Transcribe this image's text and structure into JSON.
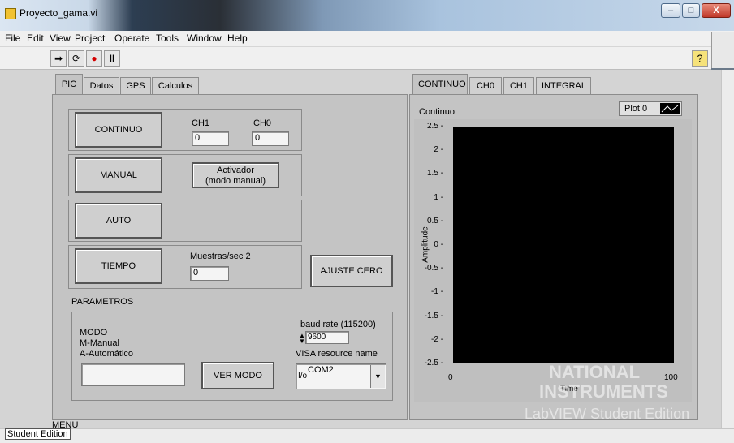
{
  "window": {
    "title": "Proyecto_gama.vi",
    "buttons": {
      "minimize": "–",
      "maximize": "□",
      "close": "X"
    }
  },
  "menu": [
    "File",
    "Edit",
    "View",
    "Project",
    "Operate",
    "Tools",
    "Window",
    "Help"
  ],
  "toolbar": {
    "run": "➡",
    "run_continuous": "⟳",
    "abort": "●",
    "pause": "II",
    "help": "?"
  },
  "left_tabs": {
    "tabs": [
      "PIC",
      "Datos",
      "GPS",
      "Calculos"
    ],
    "active": "PIC"
  },
  "pic": {
    "continuo_btn": "CONTINUO",
    "ch1_label": "CH1",
    "ch0_label": "CH0",
    "ch1_value": "0",
    "ch0_value": "0",
    "manual_btn": "MANUAL",
    "activador_line1": "Activador",
    "activador_line2": "(modo manual)",
    "auto_btn": "AUTO",
    "tiempo_btn": "TIEMPO",
    "muestras_label": "Muestras/sec 2",
    "muestras_value": "0",
    "ajuste_btn": "AJUSTE CERO",
    "parametros_label": "PARAMETROS",
    "modo_line1": "MODO",
    "modo_line2": "M-Manual",
    "modo_line3": "A-Automático",
    "modo_value": "",
    "ver_modo_btn": "VER MODO",
    "baud_label": "baud rate (115200)",
    "baud_value": "9600",
    "visa_label": "VISA resource name",
    "visa_value": "COM2",
    "menu_label": "MENU"
  },
  "right_tabs": {
    "tabs": [
      "CONTINUO",
      "CH0",
      "CH1",
      "INTEGRAL"
    ],
    "active": "CONTINUO"
  },
  "graph": {
    "title": "Continuo",
    "legend": "Plot 0",
    "ylabel": "Amplitude",
    "xlabel": "Time",
    "yticks": [
      "2.5",
      "2",
      "1.5",
      "1",
      "0.5",
      "0",
      "-0.5",
      "-1",
      "-1.5",
      "-2",
      "-2.5"
    ],
    "xticks": [
      "0",
      "100"
    ]
  },
  "watermark": {
    "line1": "NATIONAL",
    "line2": "INSTRUMENTS",
    "line3": "LabVIEW Student Edition"
  },
  "status": {
    "student_edition": "Student Edition"
  }
}
